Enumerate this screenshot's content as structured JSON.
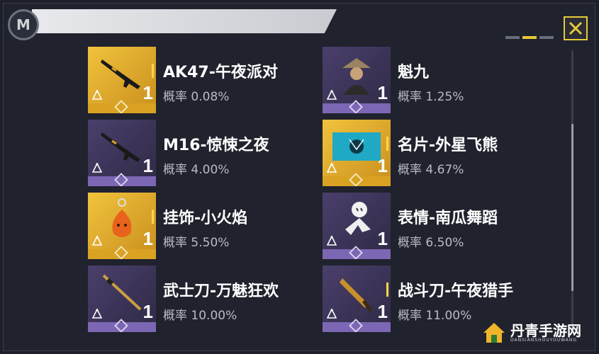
{
  "header": {
    "logo_icon": "game-logo-icon",
    "close_icon": "close-x-icon"
  },
  "items": [
    {
      "name": "AK47-午夜派对",
      "rate": "概率 0.08%",
      "qty": "1",
      "rarity": "gold",
      "icon": "rifle-icon"
    },
    {
      "name": "魁九",
      "rate": "概率 1.25%",
      "qty": "1",
      "rarity": "purple",
      "icon": "character-icon"
    },
    {
      "name": "M16-惊悚之夜",
      "rate": "概率 4.00%",
      "qty": "1",
      "rarity": "purple",
      "icon": "rifle-icon"
    },
    {
      "name": "名片-外星飞熊",
      "rate": "概率 4.67%",
      "qty": "1",
      "rarity": "gold",
      "icon": "name-card-icon"
    },
    {
      "name": "挂饰-小火焰",
      "rate": "概率 5.50%",
      "qty": "1",
      "rarity": "gold",
      "icon": "flame-charm-icon"
    },
    {
      "name": "表情-南瓜舞蹈",
      "rate": "概率 6.50%",
      "qty": "1",
      "rarity": "purple",
      "icon": "pumpkin-emote-icon"
    },
    {
      "name": "武士刀-万魅狂欢",
      "rate": "概率 10.00%",
      "qty": "1",
      "rarity": "purple",
      "icon": "katana-icon"
    },
    {
      "name": "战斗刀-午夜猎手",
      "rate": "概率 11.00%",
      "qty": "1",
      "rarity": "purple",
      "icon": "combat-knife-icon"
    }
  ],
  "watermark": {
    "text": "丹青手游网",
    "sub": "DANSIANSHOUYOUWANG"
  },
  "colors": {
    "gold": "#f1c33d",
    "purple": "#4a3f6c",
    "accent": "#e7c93a",
    "background": "#20222d"
  }
}
